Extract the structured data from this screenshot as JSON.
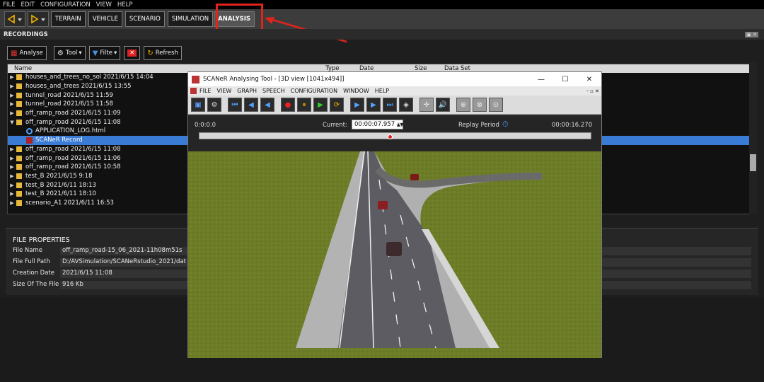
{
  "menubar": [
    "FILE",
    "EDIT",
    "CONFIGURATION",
    "VIEW",
    "HELP"
  ],
  "modes": [
    "TERRAIN",
    "VEHICLE",
    "SCENARIO",
    "SIMULATION",
    "ANALYSIS"
  ],
  "active_mode": "ANALYSIS",
  "recordings": {
    "title": "RECORDINGS",
    "toolbar": {
      "analyse": "Analyse",
      "tool": "Tool",
      "filter": "Filte",
      "refresh": "Refresh"
    },
    "columns": [
      "Name",
      "Type",
      "Date",
      "Size",
      "Data Set"
    ],
    "rows": [
      {
        "name": "houses_and_trees_no_sol 2021/6/15 14:04",
        "kind": "folder"
      },
      {
        "name": "houses_and_trees 2021/6/15 13:55",
        "kind": "folder"
      },
      {
        "name": "tunnel_road 2021/6/15 11:59",
        "kind": "folder"
      },
      {
        "name": "tunnel_road 2021/6/15 11:58",
        "kind": "folder"
      },
      {
        "name": "off_ramp_road 2021/6/15 11:09",
        "kind": "folder"
      },
      {
        "name": "off_ramp_road 2021/6/15 11:08",
        "kind": "folder-open"
      },
      {
        "name": "APPLICATION_LOG.html",
        "kind": "log"
      },
      {
        "name": "SCANeR Record",
        "kind": "record"
      },
      {
        "name": "off_ramp_road 2021/6/15 11:08",
        "kind": "folder"
      },
      {
        "name": "off_ramp_road 2021/6/15 11:06",
        "kind": "folder"
      },
      {
        "name": "off_ramp_road 2021/6/15 10:58",
        "kind": "folder"
      },
      {
        "name": "test_B 2021/6/15 9:18",
        "kind": "folder"
      },
      {
        "name": "test_B 2021/6/11 18:13",
        "kind": "folder"
      },
      {
        "name": "test_B 2021/6/11 18:10",
        "kind": "folder"
      },
      {
        "name": "scenario_A1 2021/6/11 16:53",
        "kind": "folder"
      }
    ]
  },
  "file_properties": {
    "title": "FILE PROPERTIES",
    "rows": [
      {
        "label": "File Name",
        "value": "off_ramp_road-15_06_2021-11h08m51s"
      },
      {
        "label": "File Full Path",
        "value": "D:/AVSimulation/SCANeRstudio_2021/dat"
      },
      {
        "label": "Creation Date",
        "value": "2021/6/15 11:08"
      },
      {
        "label": "Size Of The File",
        "value": "916 Kb"
      }
    ]
  },
  "analysing_window": {
    "title": "SCANeR Analysing Tool - [3D view [1041x494]]",
    "menu": [
      "FILE",
      "VIEW",
      "GRAPH",
      "SPEECH",
      "CONFIGURATION",
      "WINDOW",
      "HELP"
    ],
    "timeline": {
      "start": "0:0:0.0",
      "current_label": "Current:",
      "current_value": "00:00:07.957",
      "replay_label": "Replay Period",
      "end": "00:00:16.270",
      "progress": 0.489
    }
  },
  "colors": {
    "highlight": "#e0241b",
    "selection": "#3a7bd5",
    "folder": "#e6b93d"
  }
}
